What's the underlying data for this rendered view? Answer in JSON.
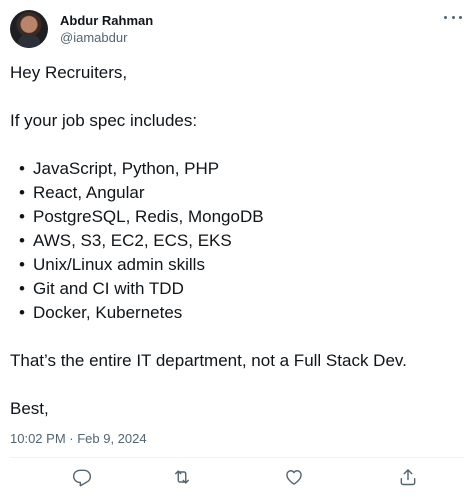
{
  "author": {
    "display_name": "Abdur Rahman",
    "handle": "@iamabdur"
  },
  "tweet": {
    "greeting": "Hey Recruiters,",
    "intro": "If your job spec includes:",
    "bullet_char": "•",
    "skills": [
      "JavaScript, Python, PHP",
      "React, Angular",
      "PostgreSQL, Redis, MongoDB",
      "AWS, S3, EC2, ECS, EKS",
      "Unix/Linux admin skills",
      "Git and CI with TDD",
      "Docker, Kubernetes"
    ],
    "conclusion": "That’s the entire IT department, not a Full Stack Dev.",
    "signoff": "Best,",
    "timestamp": "10:02 PM · Feb 9, 2024"
  },
  "actions": {
    "icons": [
      "reply-icon",
      "retweet-icon",
      "like-icon",
      "share-icon"
    ]
  },
  "colors": {
    "text": "#0f1419",
    "secondary": "#536471",
    "divider": "#eff3f4"
  }
}
